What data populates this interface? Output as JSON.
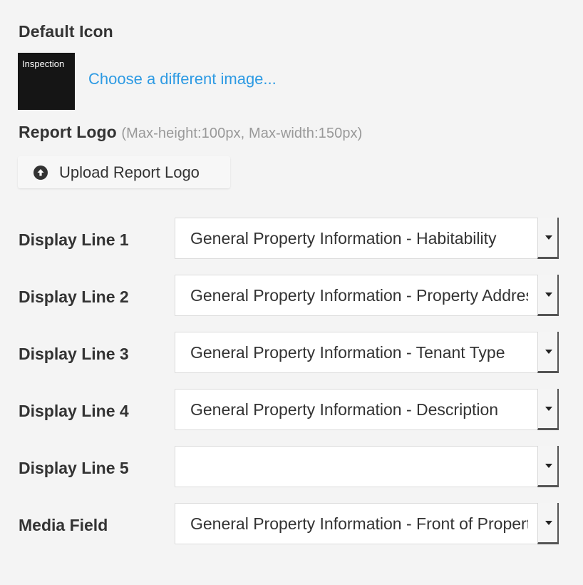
{
  "default_icon": {
    "title": "Default Icon",
    "thumbnail_text": "Inspection",
    "choose_link": "Choose a different image..."
  },
  "report_logo": {
    "title": "Report Logo",
    "hint": "(Max-height:100px, Max-width:150px)",
    "upload_label": "Upload Report Logo"
  },
  "fields": [
    {
      "label": "Display Line 1",
      "value": "General Property Information - Habitability"
    },
    {
      "label": "Display Line 2",
      "value": "General Property Information - Property Address"
    },
    {
      "label": "Display Line 3",
      "value": "General Property Information - Tenant Type"
    },
    {
      "label": "Display Line 4",
      "value": "General Property Information - Description"
    },
    {
      "label": "Display Line 5",
      "value": ""
    },
    {
      "label": "Media Field",
      "value": "General Property Information - Front of Property"
    }
  ]
}
